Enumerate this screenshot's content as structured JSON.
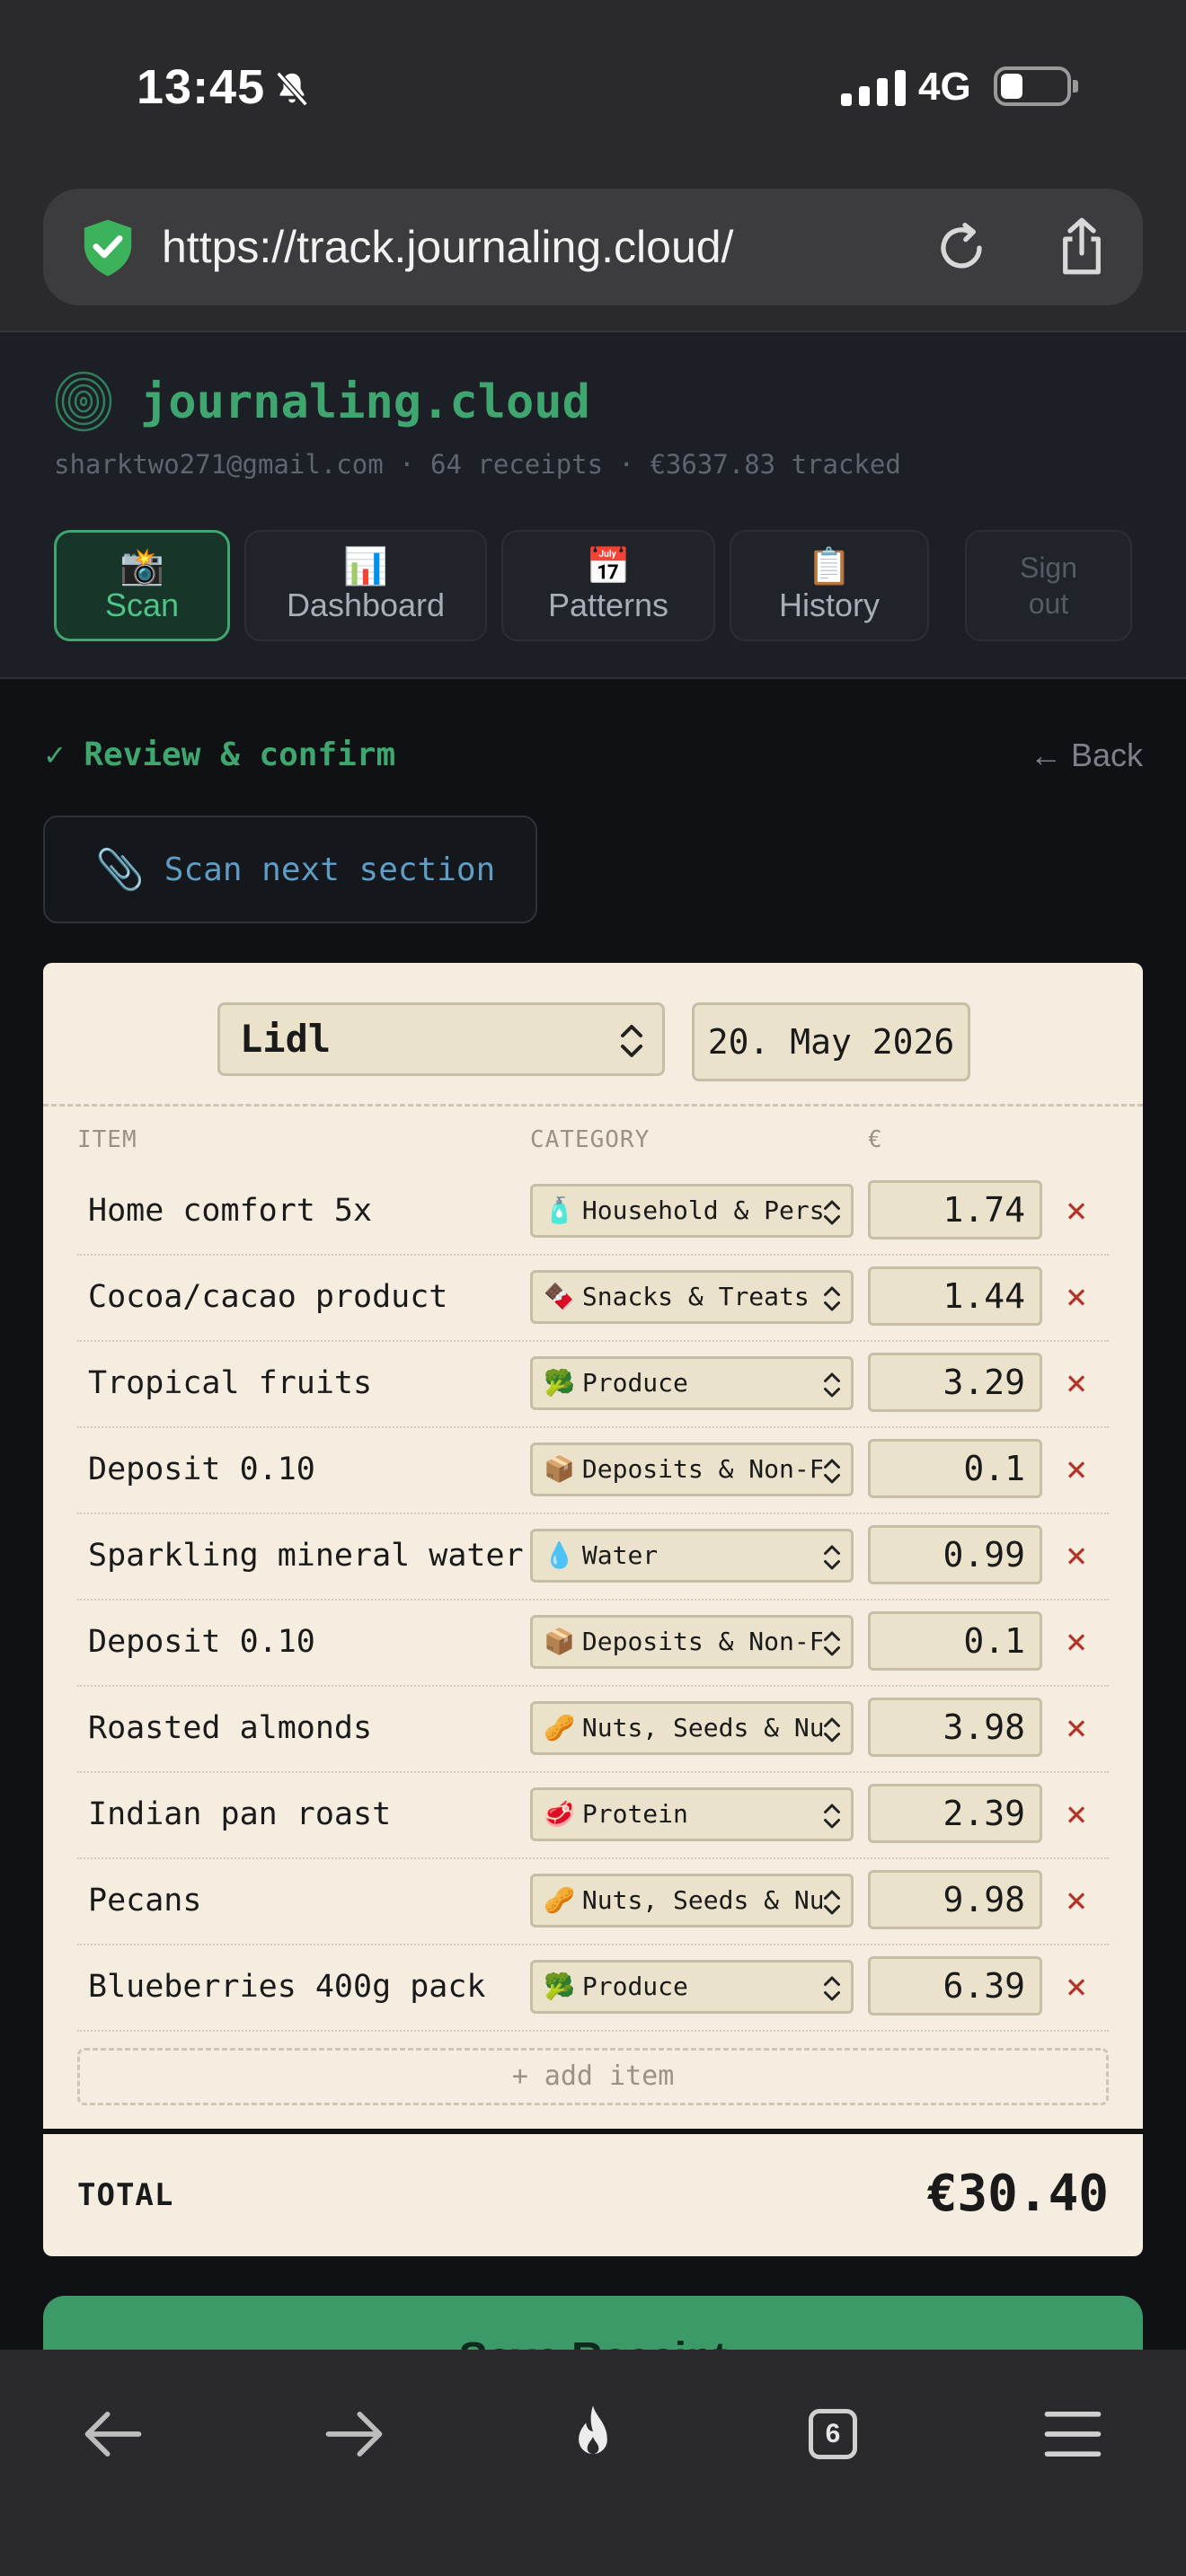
{
  "status_bar": {
    "time": "13:45",
    "network": "4G"
  },
  "browser": {
    "url": "https://track.journaling.cloud/",
    "tab_count": "6"
  },
  "app": {
    "brand": "journaling.cloud",
    "meta": "sharktwo271@gmail.com · 64 receipts · €3637.83 tracked",
    "tabs": [
      {
        "emoji": "📸",
        "label": "Scan",
        "active": true
      },
      {
        "emoji": "📊",
        "label": "Dashboard",
        "active": false
      },
      {
        "emoji": "📅",
        "label": "Patterns",
        "active": false
      },
      {
        "emoji": "📋",
        "label": "History",
        "active": false
      }
    ],
    "sign_out_line1": "Sign",
    "sign_out_line2": "out",
    "accent_color": "#3fa66f"
  },
  "review": {
    "title": "✓ Review & confirm",
    "back": "← Back",
    "scan_next_icon": "📎",
    "scan_next_label": "Scan next section"
  },
  "receipt": {
    "store": "Lidl",
    "date": "20. May 2026",
    "col_item": "ITEM",
    "col_category": "CATEGORY",
    "col_amount": "€",
    "items": [
      {
        "name": "Home comfort 5x",
        "cat_emoji": "🧴",
        "category": "Household & Personal Care",
        "amount": "1.74"
      },
      {
        "name": "Cocoa/cacao product",
        "cat_emoji": "🍫",
        "category": "Snacks & Treats",
        "amount": "1.44"
      },
      {
        "name": "Tropical fruits",
        "cat_emoji": "🥦",
        "category": "Produce",
        "amount": "3.29"
      },
      {
        "name": "Deposit 0.10",
        "cat_emoji": "📦",
        "category": "Deposits & Non-Food",
        "amount": "0.1"
      },
      {
        "name": "Sparkling mineral water",
        "cat_emoji": "💧",
        "category": "Water",
        "amount": "0.99"
      },
      {
        "name": "Deposit 0.10",
        "cat_emoji": "📦",
        "category": "Deposits & Non-Food",
        "amount": "0.1"
      },
      {
        "name": "Roasted almonds",
        "cat_emoji": "🥜",
        "category": "Nuts, Seeds & Nut Butters",
        "amount": "3.98"
      },
      {
        "name": "Indian pan roast",
        "cat_emoji": "🥩",
        "category": "Protein",
        "amount": "2.39"
      },
      {
        "name": "Pecans",
        "cat_emoji": "🥜",
        "category": "Nuts, Seeds & Nut Butters",
        "amount": "9.98"
      },
      {
        "name": "Blueberries 400g pack",
        "cat_emoji": "🥦",
        "category": "Produce",
        "amount": "6.39"
      }
    ],
    "delete_glyph": "×",
    "add_item": "+ add item",
    "total_label": "TOTAL",
    "total_value": "€30.40"
  },
  "save_button": "Save Receipt"
}
